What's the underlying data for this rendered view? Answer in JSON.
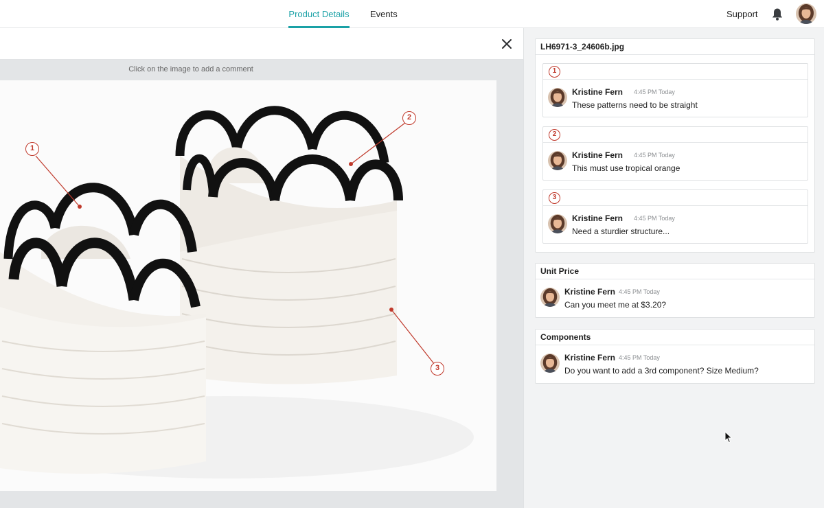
{
  "nav": {
    "tabs": [
      {
        "label": "Product Details",
        "active": true
      },
      {
        "label": "Events",
        "active": false
      }
    ],
    "support_label": "Support",
    "icons": [
      "bell-icon",
      "avatar"
    ]
  },
  "viewer": {
    "hint": "Click on the image to add a comment",
    "pins": [
      "1",
      "2",
      "3"
    ]
  },
  "file_comments": {
    "title": "LH6971-3_24606b.jpg",
    "threads": [
      {
        "number": "1",
        "author": "Kristine Fern",
        "time": "4:45 PM Today",
        "text": "These patterns need to be straight"
      },
      {
        "number": "2",
        "author": "Kristine Fern",
        "time": "4:45 PM Today",
        "text": "This must use tropical orange"
      },
      {
        "number": "3",
        "author": "Kristine Fern",
        "time": "4:45 PM Today",
        "text": "Need a sturdier structure..."
      }
    ]
  },
  "unit_price": {
    "title": "Unit Price",
    "author": "Kristine Fern",
    "time": "4:45 PM Today",
    "text": "Can you meet me at $3.20?"
  },
  "components": {
    "title": "Components",
    "author": "Kristine Fern",
    "time": "4:45 PM Today",
    "text": "Do you want to add a 3rd component? Size Medium?"
  },
  "colors": {
    "accent": "#1aa1a6",
    "pin": "#c0392b",
    "panel_bg": "#f2f3f4"
  }
}
